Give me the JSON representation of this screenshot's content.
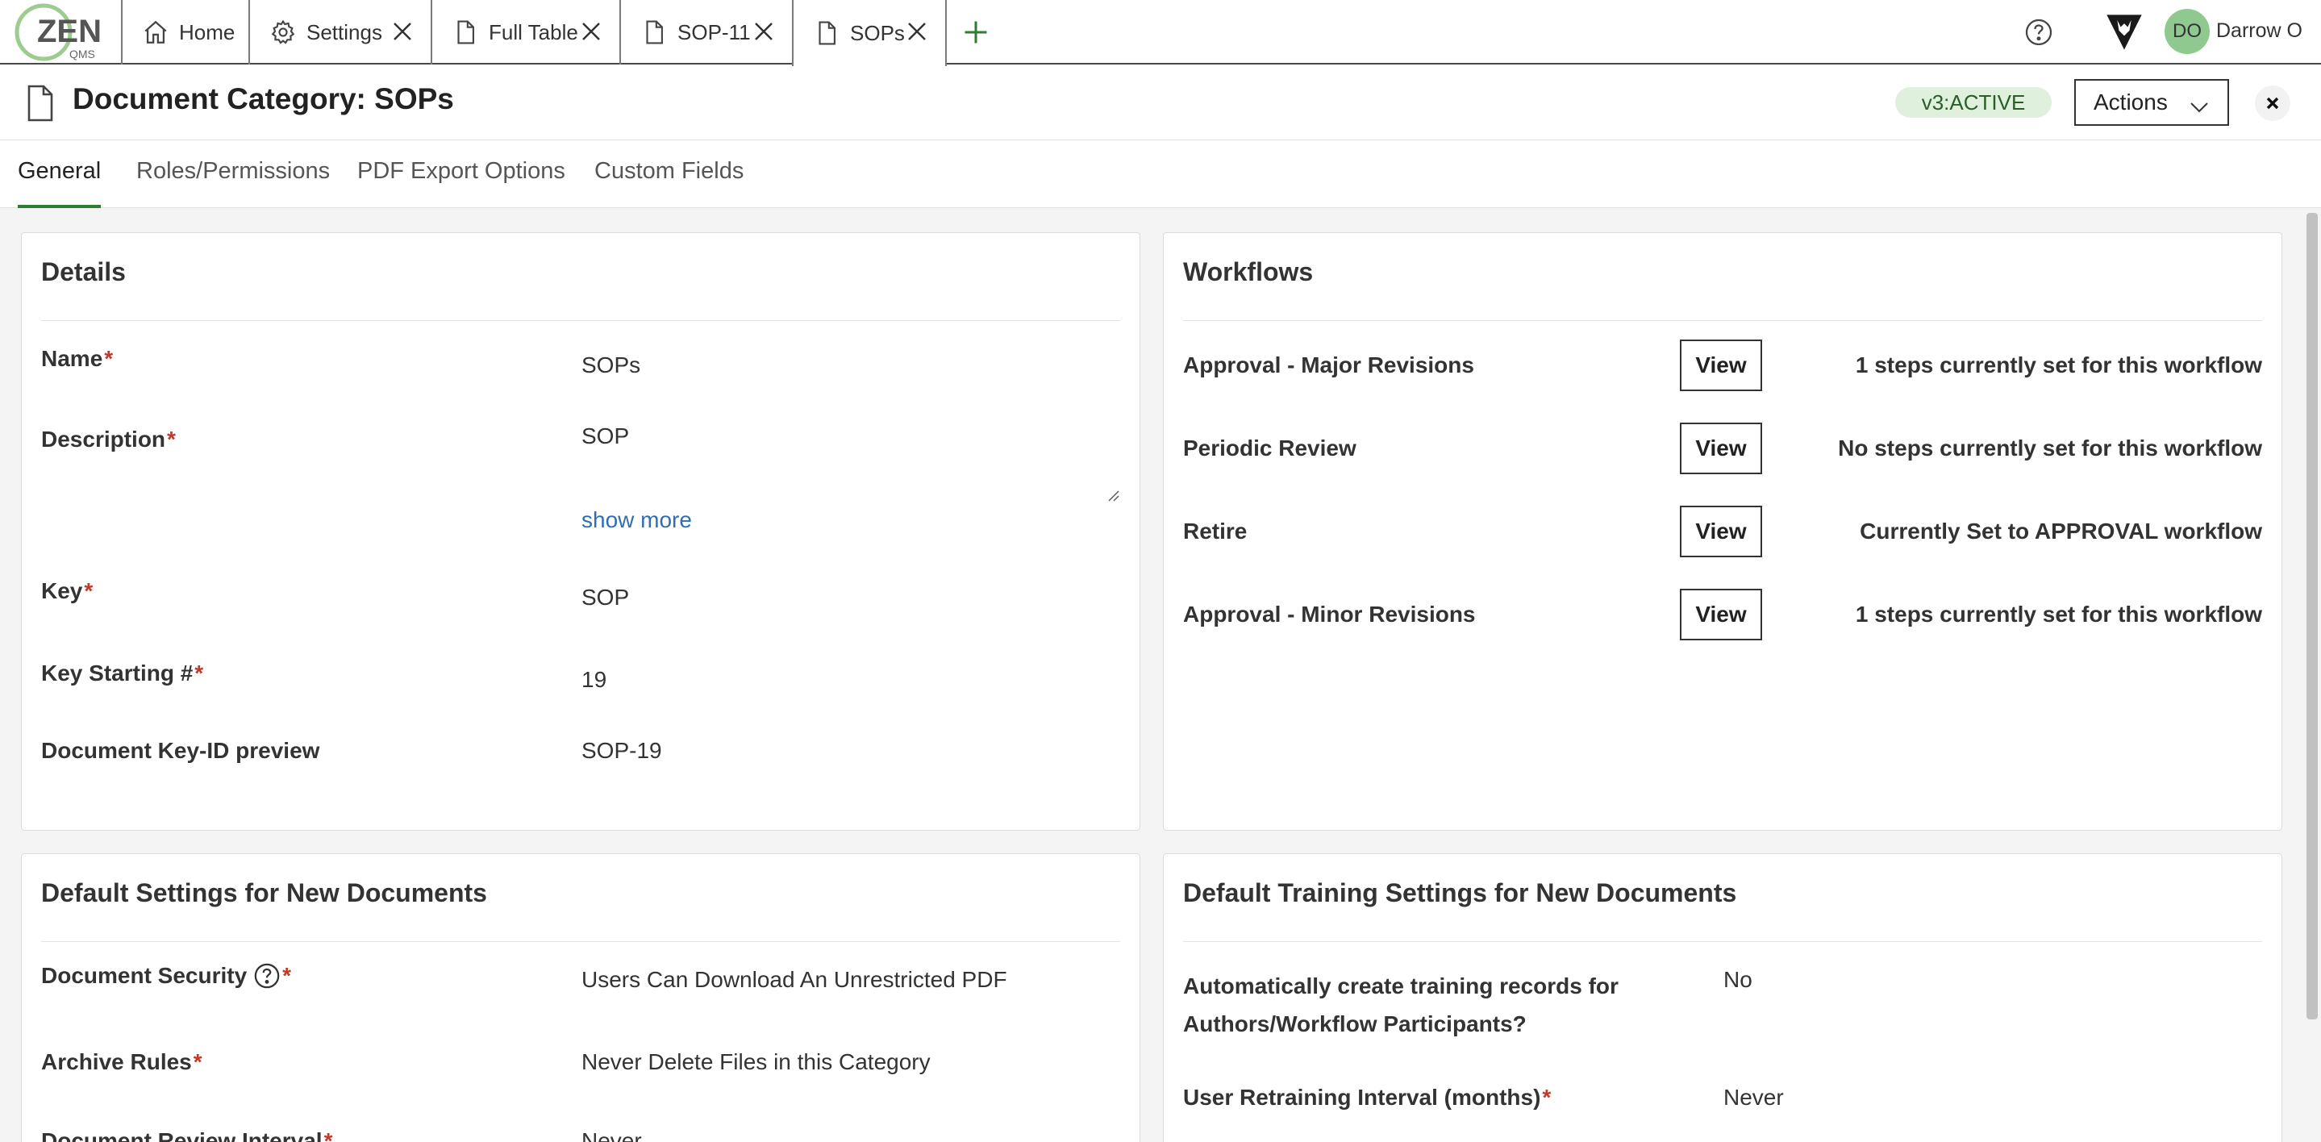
{
  "topbar": {
    "logo": {
      "text": "ZEN",
      "sub": "QMS"
    },
    "tabs": [
      {
        "label": "Home",
        "icon": "home-icon",
        "closable": false
      },
      {
        "label": "Settings",
        "icon": "gear-icon",
        "closable": true
      },
      {
        "label": "Full Table",
        "icon": "document-icon",
        "closable": true
      },
      {
        "label": "SOP-11",
        "icon": "document-icon",
        "closable": true
      },
      {
        "label": "SOPs",
        "icon": "document-icon",
        "closable": true,
        "active": true
      }
    ],
    "user": {
      "initials": "DO",
      "name": "Darrow O"
    }
  },
  "header": {
    "title": "Document Category: SOPs",
    "status": "v3:ACTIVE",
    "actions_label": "Actions"
  },
  "section_tabs": [
    {
      "label": "General",
      "active": true
    },
    {
      "label": "Roles/Permissions",
      "active": false
    },
    {
      "label": "PDF Export Options",
      "active": false
    },
    {
      "label": "Custom Fields",
      "active": false
    }
  ],
  "details": {
    "title": "Details",
    "name_label": "Name",
    "name_value": "SOPs",
    "description_label": "Description",
    "description_value": "SOP",
    "show_more": "show more",
    "key_label": "Key",
    "key_value": "SOP",
    "key_start_label": "Key Starting #",
    "key_start_value": "19",
    "preview_label": "Document Key-ID preview",
    "preview_value": "SOP-19",
    "required_mark": "*"
  },
  "workflows": {
    "title": "Workflows",
    "view_label": "View",
    "items": [
      {
        "label": "Approval - Major Revisions",
        "status": "1 steps currently set for this workflow"
      },
      {
        "label": "Periodic Review",
        "status": "No steps currently set for this workflow"
      },
      {
        "label": "Retire",
        "status": "Currently Set to APPROVAL workflow"
      },
      {
        "label": "Approval - Minor Revisions",
        "status": "1 steps currently set for this workflow"
      }
    ]
  },
  "defaults": {
    "title": "Default Settings for New Documents",
    "security_label": "Document Security",
    "security_value": "Users Can Download An Unrestricted PDF",
    "archive_label": "Archive Rules",
    "archive_value": "Never Delete Files in this Category",
    "review_label": "Document Review Interval",
    "review_value": "Never"
  },
  "training": {
    "title": "Default Training Settings for New Documents",
    "auto_label_line1": "Automatically create training records for",
    "auto_label_line2": "Authors/Workflow Participants?",
    "auto_value": "No",
    "retrain_label": "User Retraining Interval (months)",
    "retrain_value": "Never"
  },
  "colors": {
    "accent_green": "#2e7d32",
    "status_bg": "#dff0dc",
    "link_blue": "#2f6eb5",
    "required_red": "#c0392b"
  }
}
